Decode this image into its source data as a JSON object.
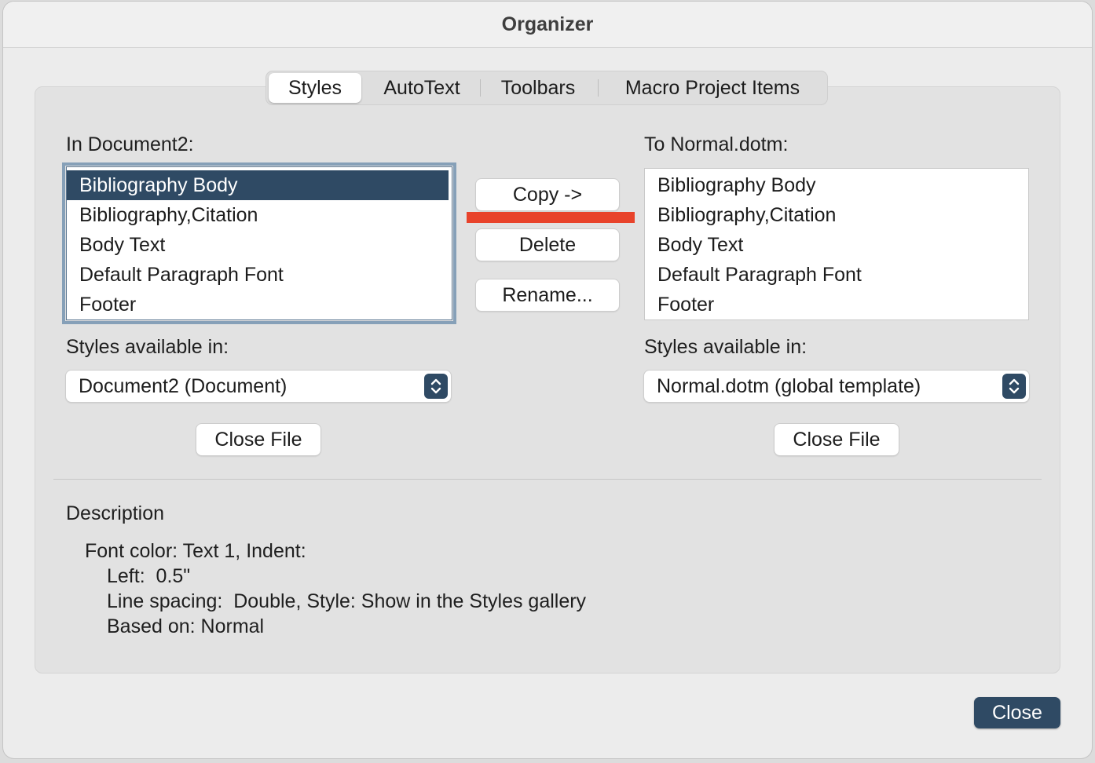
{
  "window": {
    "title": "Organizer"
  },
  "tabs": [
    {
      "label": "Styles",
      "active": true
    },
    {
      "label": "AutoText",
      "active": false
    },
    {
      "label": "Toolbars",
      "active": false
    },
    {
      "label": "Macro Project Items",
      "active": false
    }
  ],
  "left": {
    "list_label": "In Document2:",
    "items": [
      "Bibliography Body",
      "Bibliography,Citation",
      "Body Text",
      "Default Paragraph Font",
      "Footer"
    ],
    "selected_index": 0,
    "available_label": "Styles available in:",
    "available_value": "Document2 (Document)",
    "close_file_label": "Close File"
  },
  "right": {
    "list_label": "To Normal.dotm:",
    "items": [
      "Bibliography Body",
      "Bibliography,Citation",
      "Body Text",
      "Default Paragraph Font",
      "Footer"
    ],
    "available_label": "Styles available in:",
    "available_value": "Normal.dotm (global template)",
    "close_file_label": "Close File"
  },
  "actions": {
    "copy_label": "Copy ->",
    "delete_label": "Delete",
    "rename_label": "Rename..."
  },
  "description": {
    "heading": "Description",
    "lines": [
      "Font color: Text 1, Indent:",
      "Left:  0.5\"",
      "Line spacing:  Double, Style: Show in the Styles gallery",
      "Based on: Normal"
    ]
  },
  "footer": {
    "close_label": "Close"
  },
  "colors": {
    "accent": "#2f4a64",
    "annotation": "#e8432b"
  },
  "icons": {
    "stepper": "up-down-chevron-icon"
  }
}
